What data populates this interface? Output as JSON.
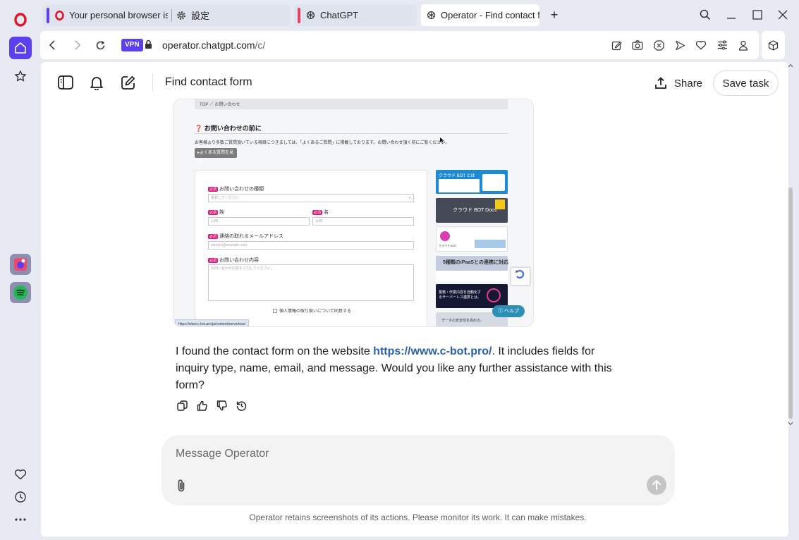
{
  "browser": {
    "tabs": [
      {
        "label": "Your personal browser is a",
        "accent": "#5b3ff0"
      },
      {
        "label": "設定"
      },
      {
        "label": "ChatGPT",
        "accent": "#e64262"
      },
      {
        "label": "Operator - Find contact fo",
        "active": true
      }
    ],
    "new_tab": "+",
    "vpn_badge": "VPN",
    "url_host": "operator.chatgpt.com",
    "url_path": "/c/"
  },
  "header": {
    "title": "Find contact form",
    "share_label": "Share",
    "save_label": "Save task"
  },
  "screenshot": {
    "breadcrumb": "TOP ／ お問い合わせ",
    "heading": "お問い合わせの前に",
    "notice": "お客様より多数ご質問頂いている項目につきましては、「よくあるご質問」に掲載しております。お問い合わせ頂く前にご覧ください。",
    "faq_button": "▸よくある質問を見る",
    "required_badge": "必須",
    "field_type_label": "お問い合わせの種類",
    "field_type_placeholder": "選択してください",
    "field_lastname_label": "姓",
    "field_lastname_placeholder": "山田",
    "field_firstname_label": "名",
    "field_firstname_placeholder": "太郎",
    "field_email_label": "連絡の取れるメールアドレス",
    "field_email_placeholder": "sample@example.com",
    "field_message_label": "お問い合わせ内容",
    "field_message_placeholder": "お問い合わせ内容を入力してください。",
    "consent": "個人情報の取り扱いについて同意する",
    "ad1": "クラウド BOT とは",
    "ad2": "クラウド BOT Docs",
    "ad3": "クラウド BOT",
    "ad4": "5種類のiPaaSとの連携に対応",
    "ad5": "業務・作業内容を自動化するサーバーレス連携とは。",
    "ad6": "データの安全性を高める。",
    "help_button": "ヘルプ",
    "status_url": "https://www.c-bot.pro/ja/content/serverless/"
  },
  "message": {
    "text_before": "I found the contact form on the website ",
    "link": "https://www.c-bot.pro/",
    "text_after": ". It includes fields for inquiry type, name, email, and message. Would you like any further assistance with this form?"
  },
  "composer": {
    "placeholder": "Message Operator"
  },
  "disclaimer": "Operator retains screenshots of its actions. Please monitor its work. It can make mistakes."
}
